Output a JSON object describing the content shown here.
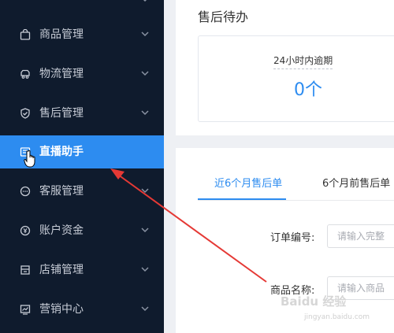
{
  "sidebar": {
    "items": [
      {
        "label": "商品管理",
        "icon": "bag-icon"
      },
      {
        "label": "物流管理",
        "icon": "truck-icon"
      },
      {
        "label": "售后管理",
        "icon": "shield-icon"
      },
      {
        "label": "直播助手",
        "icon": "live-icon",
        "active": true
      },
      {
        "label": "客服管理",
        "icon": "chat-icon"
      },
      {
        "label": "账户资金",
        "icon": "coin-icon"
      },
      {
        "label": "店铺管理",
        "icon": "store-icon"
      },
      {
        "label": "营销中心",
        "icon": "chart-icon"
      }
    ]
  },
  "aftersales": {
    "title": "售后待办",
    "stat_label": "24小时内逾期",
    "stat_value": "0个"
  },
  "tabs": {
    "active": "近6个月售后单",
    "inactive": "6个月前售后单"
  },
  "form": {
    "order_label": "订单编号:",
    "order_placeholder": "请输入完整",
    "product_label": "商品名称:",
    "product_placeholder": "请输入商品"
  },
  "watermark": {
    "brand": "Baidu 经验",
    "url": "jingyan.baidu.com"
  },
  "colors": {
    "sidebar_bg": "#0f1b2d",
    "accent": "#2d8cf0",
    "annotation": "#e53935"
  }
}
